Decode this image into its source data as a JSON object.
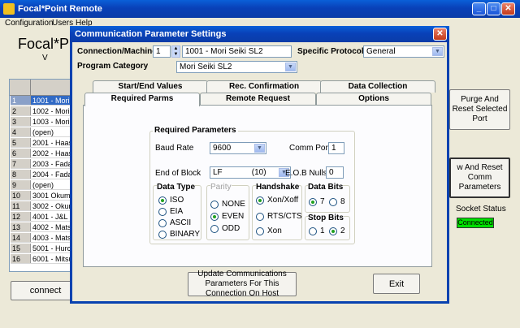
{
  "main": {
    "title": "Focal*Point Remote",
    "menu": [
      "Configuration",
      "Users",
      "Help"
    ],
    "heading": "Focal*P",
    "heading_sub": "V",
    "rows": [
      {
        "n": "1",
        "t": "1001 - Mori S"
      },
      {
        "n": "2",
        "t": "1002 - Mori S"
      },
      {
        "n": "3",
        "t": "1003 - Mori S"
      },
      {
        "n": "4",
        "t": "(open)"
      },
      {
        "n": "5",
        "t": "2001 - Haas"
      },
      {
        "n": "6",
        "t": "2002 - Haas"
      },
      {
        "n": "7",
        "t": "2003 - Fadal"
      },
      {
        "n": "8",
        "t": "2004 - Fadal"
      },
      {
        "n": "9",
        "t": "(open)"
      },
      {
        "n": "10",
        "t": "3001 Okuma"
      },
      {
        "n": "11",
        "t": "3002 - Okum"
      },
      {
        "n": "12",
        "t": "4001 - J&L 8"
      },
      {
        "n": "13",
        "t": "4002 - Matsu"
      },
      {
        "n": "14",
        "t": "4003 - Matsu"
      },
      {
        "n": "15",
        "t": "5001 - Hurco"
      },
      {
        "n": "16",
        "t": "6001 - Mitsul"
      }
    ],
    "connect_label": "connect",
    "purge_label": "Purge And Reset Selected Port",
    "reset_comm_label": "w And Reset Comm Parameters",
    "socket_status_label": "Socket Status",
    "socket_status_value": "Connected"
  },
  "dialog": {
    "title": "Communication Parameter Settings",
    "connection_label": "Connection/Machine",
    "connection_number": "1",
    "connection_name": "1001 - Mori Seiki SL2",
    "protocol_label": "Specific Protocol",
    "protocol_value": "General",
    "category_label": "Program Category",
    "category_value": "Mori Seiki SL2",
    "tabs_back": [
      "Start/End Values",
      "Rec. Confirmation",
      "Data Collection"
    ],
    "tabs_front": [
      "Required Parms",
      "Remote Request",
      "Options"
    ],
    "required_title": "Required Parameters",
    "baud_label": "Baud Rate",
    "baud_value": "9600",
    "comm_port_label": "Comm Port:",
    "comm_port_value": "1",
    "eob_label": "End of Block",
    "eob_value": "LF             (10)",
    "eob_nulls_label": "E.O.B Nulls:",
    "eob_nulls_value": "0",
    "data_type_title": "Data Type",
    "data_type_options": [
      "ISO",
      "EIA",
      "ASCII",
      "BINARY"
    ],
    "parity_title": "Parity",
    "parity_options": [
      "NONE",
      "EVEN",
      "ODD"
    ],
    "handshake_title": "Handshake",
    "handshake_options": [
      "Xon/Xoff",
      "RTS/CTS",
      "Xon"
    ],
    "data_bits_title": "Data Bits",
    "data_bits_options": [
      "7",
      "8"
    ],
    "stop_bits_title": "Stop Bits",
    "stop_bits_options": [
      "1",
      "2"
    ],
    "update_label": "Update Communications Parameters For This Connection On Host",
    "exit_label": "Exit",
    "colors": {
      "title_bar": "#0a4fd0",
      "connected": "#00e000"
    }
  }
}
